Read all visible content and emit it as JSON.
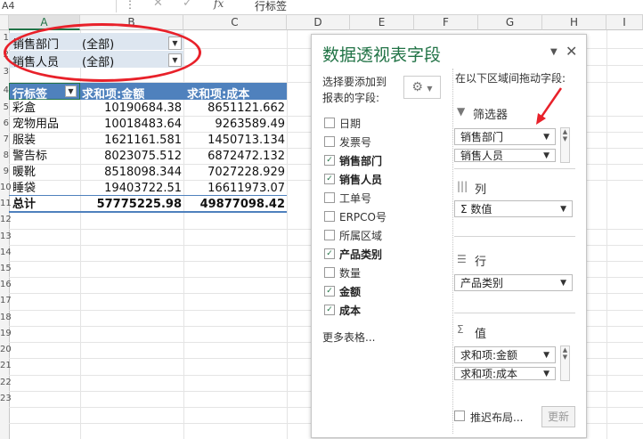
{
  "formula_bar": {
    "name_box": "A4",
    "more": "⋮",
    "cancel": "✕",
    "enter": "✓",
    "fx": "fx",
    "value": "行标签"
  },
  "columns": [
    "A",
    "B",
    "C",
    "D",
    "E",
    "F",
    "G",
    "H",
    "I"
  ],
  "rows": [
    "1",
    "2",
    "3",
    "4",
    "5",
    "6",
    "7",
    "8",
    "9",
    "10",
    "11",
    "12",
    "13",
    "14",
    "15",
    "16",
    "17",
    "18",
    "19",
    "20",
    "21",
    "22",
    "23"
  ],
  "filters": [
    {
      "label": "销售部门",
      "value": "(全部)"
    },
    {
      "label": "销售人员",
      "value": "(全部)"
    }
  ],
  "pivot": {
    "headers": [
      "行标签",
      "求和项:金额",
      "求和项:成本"
    ],
    "rows": [
      {
        "label": "彩盒",
        "amount": "10190684.38",
        "cost": "8651121.662"
      },
      {
        "label": "宠物用品",
        "amount": "10018483.64",
        "cost": "9263589.49"
      },
      {
        "label": "服装",
        "amount": "1621161.581",
        "cost": "1450713.134"
      },
      {
        "label": "警告标",
        "amount": "8023075.512",
        "cost": "6872472.132"
      },
      {
        "label": "暖靴",
        "amount": "8518098.344",
        "cost": "7027228.929"
      },
      {
        "label": "睡袋",
        "amount": "19403722.51",
        "cost": "16611973.07"
      }
    ],
    "total": {
      "label": "总计",
      "amount": "57775225.98",
      "cost": "49877098.42"
    }
  },
  "field_list": {
    "title": "数据透视表字段",
    "choose_label_1": "选择要添加到",
    "choose_label_2": "报表的字段:",
    "drag_label": "在以下区域间拖动字段:",
    "fields": [
      {
        "name": "日期",
        "checked": false
      },
      {
        "name": "发票号",
        "checked": false
      },
      {
        "name": "销售部门",
        "checked": true
      },
      {
        "name": "销售人员",
        "checked": true
      },
      {
        "name": "工单号",
        "checked": false
      },
      {
        "name": "ERPCO号",
        "checked": false
      },
      {
        "name": "所属区域",
        "checked": false
      },
      {
        "name": "产品类别",
        "checked": true
      },
      {
        "name": "数量",
        "checked": false
      },
      {
        "name": "金额",
        "checked": true
      },
      {
        "name": "成本",
        "checked": true
      }
    ],
    "more_tables": "更多表格...",
    "areas": {
      "filters": {
        "title": "筛选器",
        "items": [
          "销售部门",
          "销售人员"
        ]
      },
      "columns": {
        "title": "列",
        "items": [
          "Σ 数值"
        ]
      },
      "rows": {
        "title": "行",
        "items": [
          "产品类别"
        ]
      },
      "values": {
        "title": "值",
        "items": [
          "求和项:金额",
          "求和项:成本"
        ]
      }
    },
    "defer_label": "推迟布局...",
    "update_label": "更新"
  },
  "colors": {
    "accent": "#217346",
    "pivot_header": "#4f81bd",
    "annotation": "#e8212a",
    "filter_bg": "#dde6f0"
  }
}
